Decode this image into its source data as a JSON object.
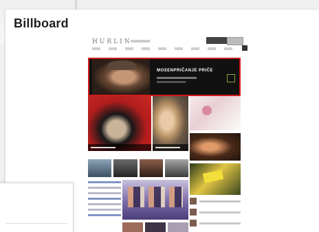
{
  "card": {
    "title": "Billboard"
  },
  "site": {
    "logo_text": "HURLIN",
    "billboard_headline": "MOSENPRIČANJE PRIČE"
  },
  "highlight_color": "#d21b1b"
}
